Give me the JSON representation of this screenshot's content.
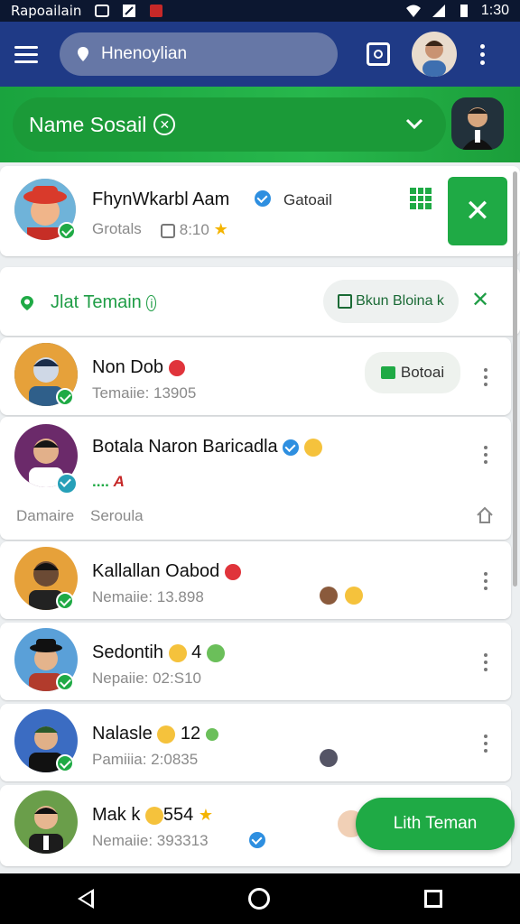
{
  "status_bar": {
    "carrier": "Rapoailain",
    "time": "1:30"
  },
  "app_bar": {
    "search_placeholder": "Hnenoylian",
    "icons": [
      "menu-icon",
      "pin-icon",
      "camera-icon",
      "avatar",
      "more-vert-icon"
    ]
  },
  "header": {
    "title": "Name Sosail"
  },
  "top_card": {
    "name": "FhynWkarbl Aam",
    "tag": "Gatoail",
    "sub": "Grotals",
    "time": "8:10"
  },
  "section": {
    "title": "Jlat Temain",
    "chip_label": "Bkun Bloina k"
  },
  "rows": [
    {
      "name": "Non Dob",
      "sub": "Temaiie: 13905",
      "button": "Botoai"
    },
    {
      "name": "Botala Naron Baricadla",
      "sub": "....",
      "left_label": "Damaire",
      "right_label": "Seroula"
    },
    {
      "name": "Kallallan Oabod",
      "sub": "Nemaiie: 13.898"
    },
    {
      "name": "Sedontih",
      "count": "4",
      "sub": "Nepaiie: 02:S10"
    },
    {
      "name": "Nalasle",
      "count": "12",
      "sub": "Pamiiia: 2:0835"
    },
    {
      "name": "Mak k",
      "count": "554",
      "sub": "Nemaiie: 393313"
    }
  ],
  "fab": {
    "label": "Lith Teman"
  },
  "colors": {
    "primary": "#1f3a86",
    "accent": "#1faa45"
  }
}
